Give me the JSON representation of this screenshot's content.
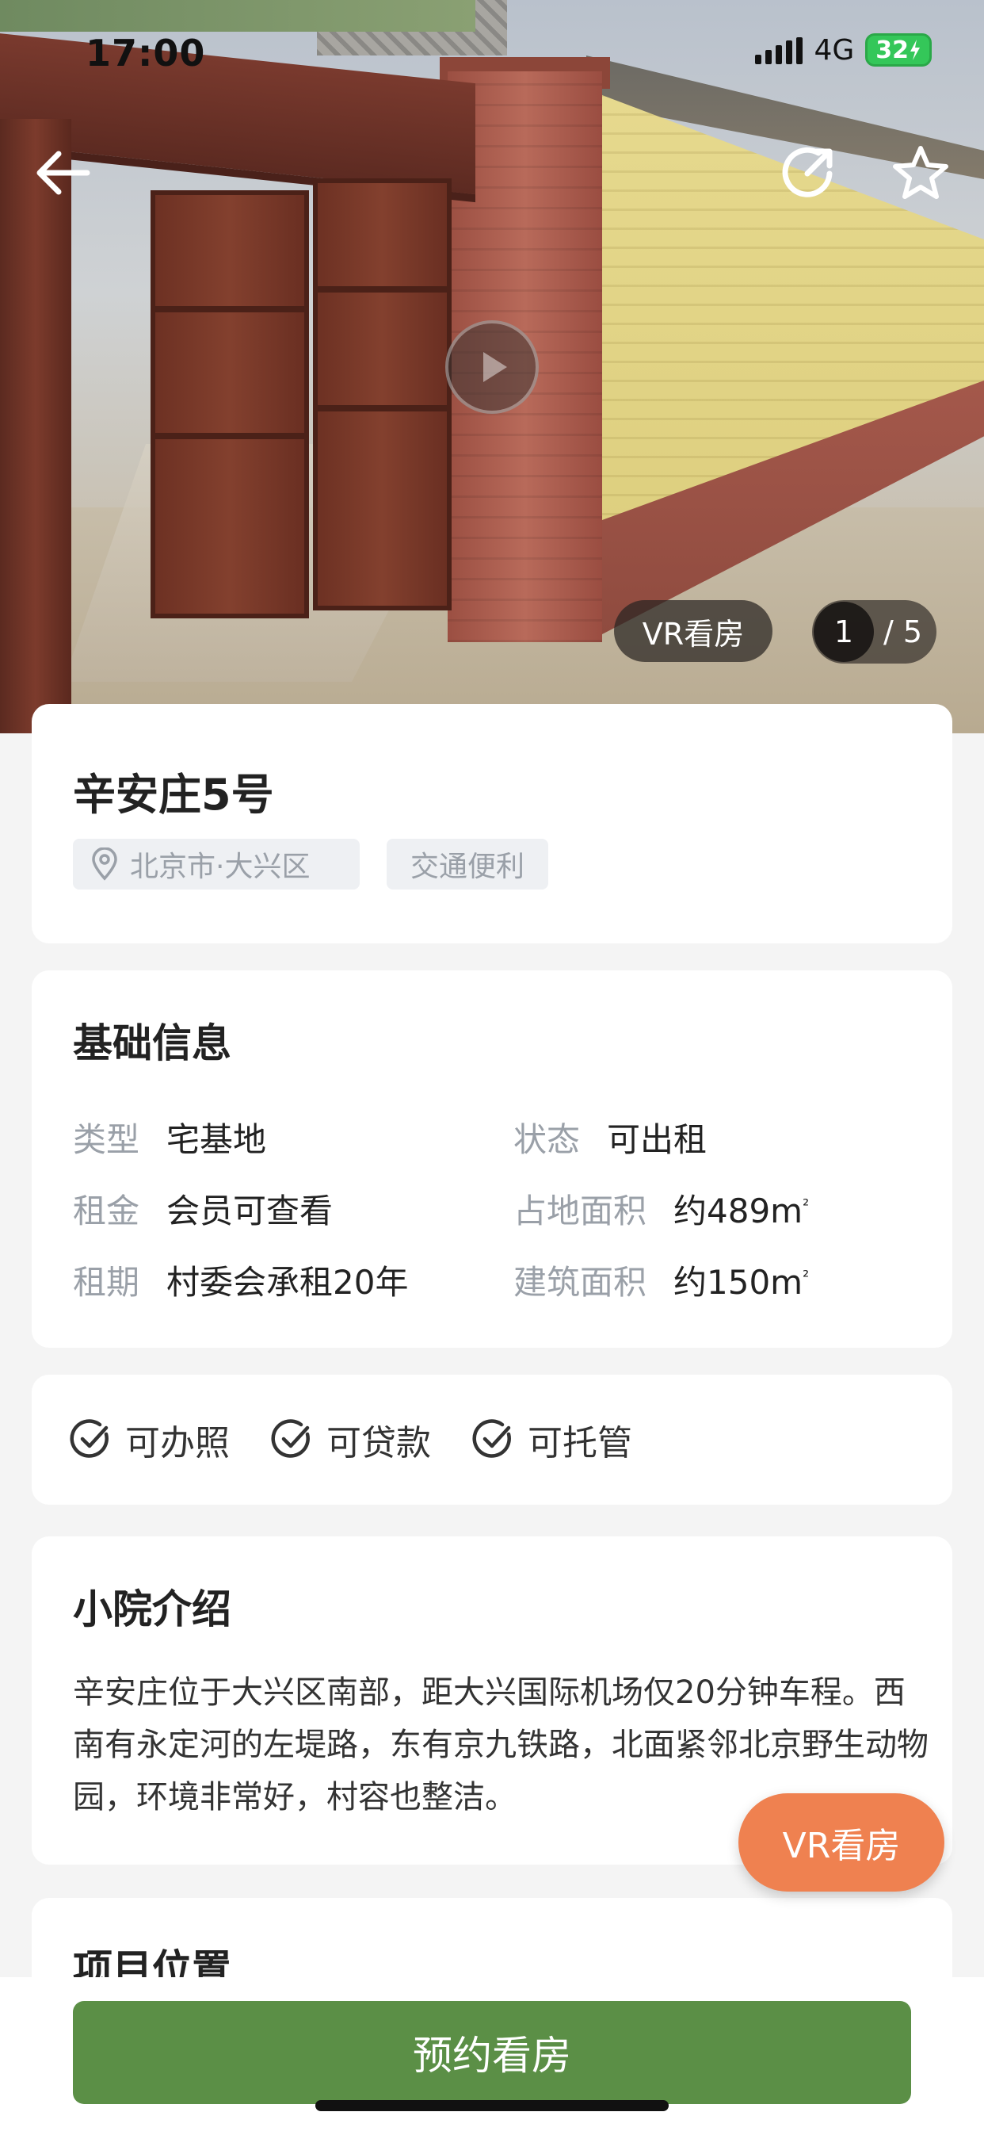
{
  "status_bar": {
    "time": "17:00",
    "network": "4G",
    "battery": "32"
  },
  "hero": {
    "vr_label": "VR看房",
    "image_index": "1",
    "separator": "/",
    "image_total": "5"
  },
  "property": {
    "title": "辛安庄5号",
    "location_tag": "北京市·大兴区",
    "feature_tag": "交通便利"
  },
  "basic_info": {
    "title": "基础信息",
    "items": [
      {
        "label": "类型",
        "value": "宅基地"
      },
      {
        "label": "状态",
        "value": "可出租"
      },
      {
        "label": "租金",
        "value": "会员可查看"
      },
      {
        "label": "占地面积",
        "value": "约489m",
        "unit_sup": "²"
      },
      {
        "label": "租期",
        "value": "村委会承租20年"
      },
      {
        "label": "建筑面积",
        "value": "约150m",
        "unit_sup": "²"
      }
    ]
  },
  "features": [
    {
      "label": "可办照"
    },
    {
      "label": "可贷款"
    },
    {
      "label": "可托管"
    }
  ],
  "intro": {
    "title": "小院介绍",
    "text": "辛安庄位于大兴区南部，距大兴国际机场仅20分钟车程。西南有永定河的左堤路，东有京九铁路，北面紧邻北京野生动物园，环境非常好，村容也整洁。"
  },
  "location": {
    "title": "项目位置"
  },
  "vr_fab_label": "VR看房",
  "book_button_label": "预约看房",
  "colors": {
    "primary_green": "#5b8f46",
    "vr_orange": "#ef8150",
    "battery_green": "#34c759"
  }
}
